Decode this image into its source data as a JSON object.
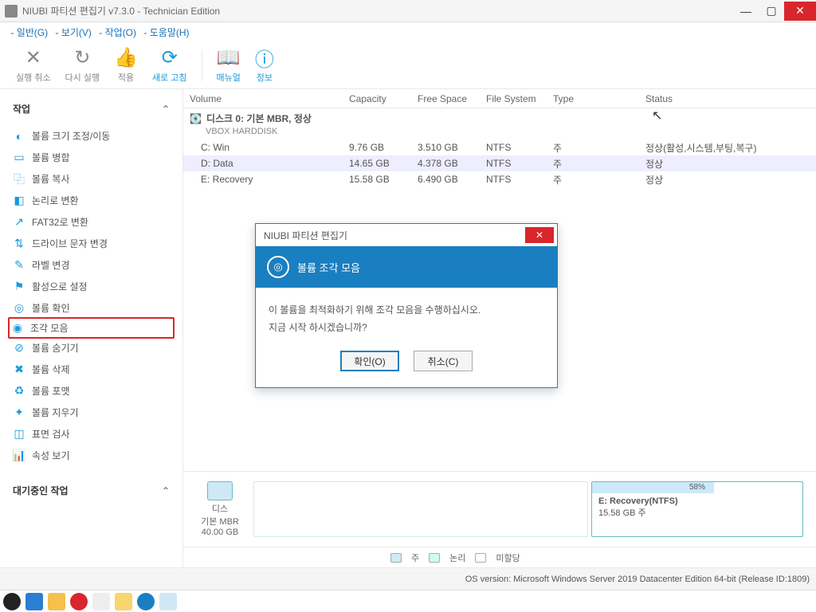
{
  "titlebar": {
    "title": "NIUBI 파티션 편집기 v7.3.0 - Technician Edition"
  },
  "menu": {
    "general": "일반(G)",
    "view": "보기(V)",
    "task": "작업(O)",
    "help": "도움말(H)"
  },
  "toolbar": {
    "undo": "실행 취소",
    "redo": "다시 실행",
    "apply": "적용",
    "refresh": "새로 고침",
    "manual": "매뉴얼",
    "info": "정보"
  },
  "sidebar": {
    "section1": "작업",
    "t1": "볼륨 크기 조정/이동",
    "t2": "볼륨 병합",
    "t3": "볼륨 복사",
    "t4": "논리로 변환",
    "t5": "FAT32로 변환",
    "t6": "드라이브 문자 변경",
    "t7": "라벨 변경",
    "t8": "활성으로 설정",
    "t9": "볼륨 확인",
    "t10": "조각 모음",
    "t11": "볼륨 숨기기",
    "t12": "볼륨 삭제",
    "t13": "볼륨 포맷",
    "t14": "볼륨 지우기",
    "t15": "표면 검사",
    "t16": "속성 보기",
    "section2": "대기중인 작업"
  },
  "columns": {
    "volume": "Volume",
    "capacity": "Capacity",
    "free": "Free Space",
    "fs": "File System",
    "type": "Type",
    "status": "Status"
  },
  "disk": {
    "title": "디스크 0: 기본 MBR, 정상",
    "sub": "VBOX HARDDISK"
  },
  "rows": [
    {
      "vol": "C: Win",
      "cap": "9.76 GB",
      "free": "3.510 GB",
      "fs": "NTFS",
      "type": "주",
      "status": "정상(활성,시스템,부팅,복구)"
    },
    {
      "vol": "D: Data",
      "cap": "14.65 GB",
      "free": "4.378 GB",
      "fs": "NTFS",
      "type": "주",
      "status": "정상"
    },
    {
      "vol": "E: Recovery",
      "cap": "15.58 GB",
      "free": "6.490 GB",
      "fs": "NTFS",
      "type": "주",
      "status": "정상"
    }
  ],
  "diskmap": {
    "disklabel1": "디스",
    "disklabel2": "기본 MBR",
    "disklabel3": "40.00 GB",
    "p3pct": "58%",
    "p3name": "E: Recovery(NTFS)",
    "p3size": "15.58 GB 주"
  },
  "legend": {
    "l1": "주",
    "l2": "논리",
    "l3": "미할당"
  },
  "statusbar": {
    "os": "OS version: Microsoft Windows Server 2019 Datacenter Edition  64-bit  (Release ID:1809)"
  },
  "dialog": {
    "title": "NIUBI 파티션 편집기",
    "headline": "볼륨 조각 모음",
    "line1": "이 볼륨을 최적화하기 위해 조각 모음을 수행하십시오.",
    "line2": "지금 시작 하시겠습니까?",
    "ok": "확인(O)",
    "cancel": "취소(C)"
  }
}
